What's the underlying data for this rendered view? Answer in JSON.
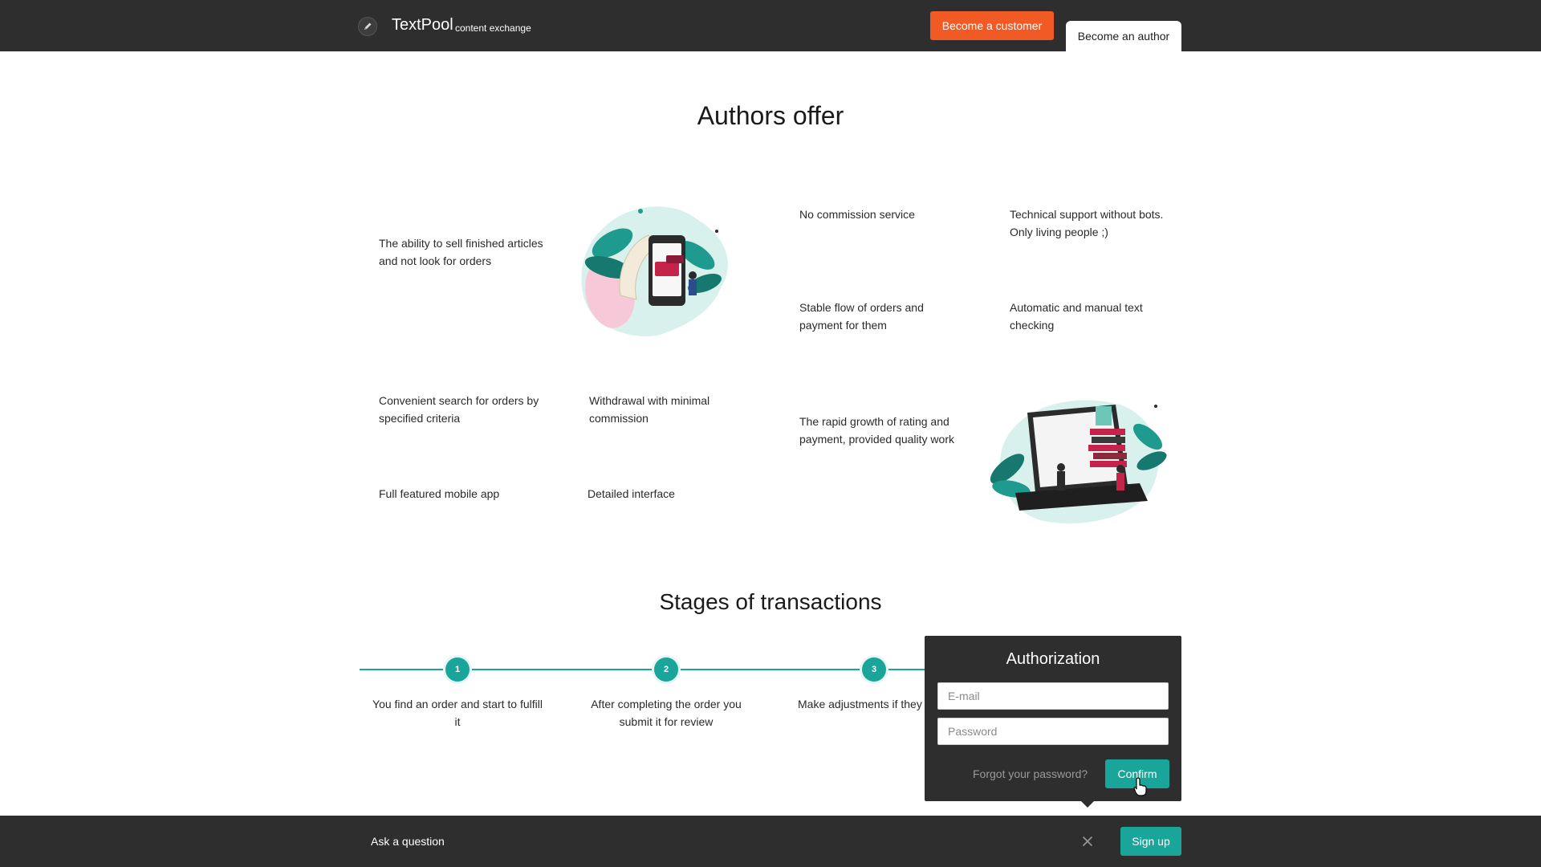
{
  "header": {
    "brand": "TextPool",
    "brand_sub": "content exchange",
    "customer_button": "Become a customer",
    "author_button": "Become an author",
    "icon": "pen-icon"
  },
  "authors_offer": {
    "title": "Authors offer",
    "features": [
      "The ability to sell finished articles and not look for orders",
      "No commission service",
      "Technical support without bots. Only living people ;)",
      "Stable flow of orders and payment for them",
      "Automatic and manual text checking",
      "Convenient search for orders by specified criteria",
      "Withdrawal with minimal commission",
      "The rapid growth of rating and payment, provided quality work",
      "Full featured mobile app",
      "Detailed interface"
    ]
  },
  "stages": {
    "title": "Stages of transactions",
    "steps": [
      {
        "number": "1",
        "text": "You find an order and start to fulfill it"
      },
      {
        "number": "2",
        "text": "After completing the order you submit it for review"
      },
      {
        "number": "3",
        "text": "Make adjustments if they"
      }
    ]
  },
  "auth": {
    "title": "Authorization",
    "email_placeholder": "E-mail",
    "password_placeholder": "Password",
    "forgot": "Forgot your password?",
    "confirm": "Confirm"
  },
  "footer": {
    "ask": "Ask a question",
    "signup": "Sign up",
    "close_icon": "close-icon"
  },
  "colors": {
    "bar": "#2e2e2e",
    "orange": "#f15a24",
    "teal": "#1aa59a"
  }
}
